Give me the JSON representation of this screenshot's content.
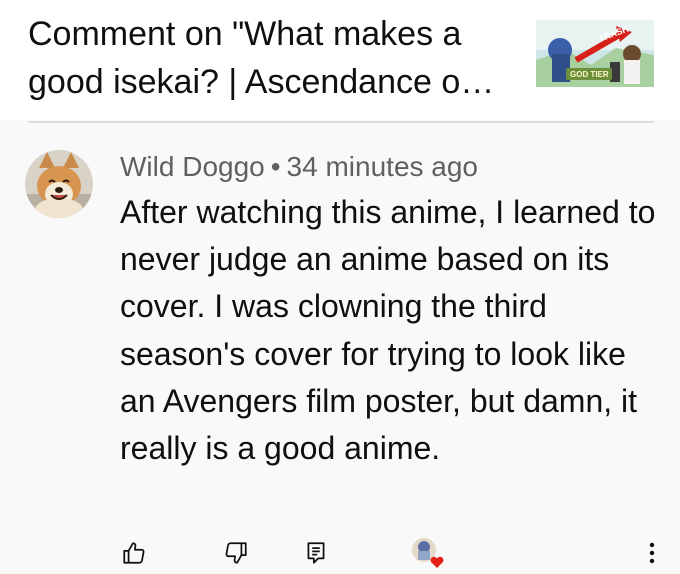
{
  "header": {
    "title": "Comment on \"What makes a good isekai? | Ascendance of …",
    "thumbnail": {
      "icon": "video-thumbnail",
      "text_top": "TRASH",
      "text_bottom": "GOD TIER"
    }
  },
  "comment": {
    "author": "Wild Doggo",
    "separator": "•",
    "timestamp": "34 minutes ago",
    "avatar_icon": "shiba-dog-avatar",
    "text": "After watching this anime, I learned to never judge an anime based on its cover. I was clowning the third season's cover for trying to look like an Avengers film poster, but damn, it really is a good anime."
  },
  "actions": [
    {
      "name": "like-button",
      "icon": "thumbs-up-icon"
    },
    {
      "name": "dislike-button",
      "icon": "thumbs-down-icon"
    },
    {
      "name": "reply-button",
      "icon": "reply-icon"
    },
    {
      "name": "creator-heart",
      "icon": "creator-heart-icon"
    },
    {
      "name": "more-button",
      "icon": "more-vertical-icon"
    }
  ],
  "colors": {
    "heart": "#e62117",
    "meta": "#606060",
    "text": "#0f0f0f",
    "background": "#f9f9f9"
  }
}
